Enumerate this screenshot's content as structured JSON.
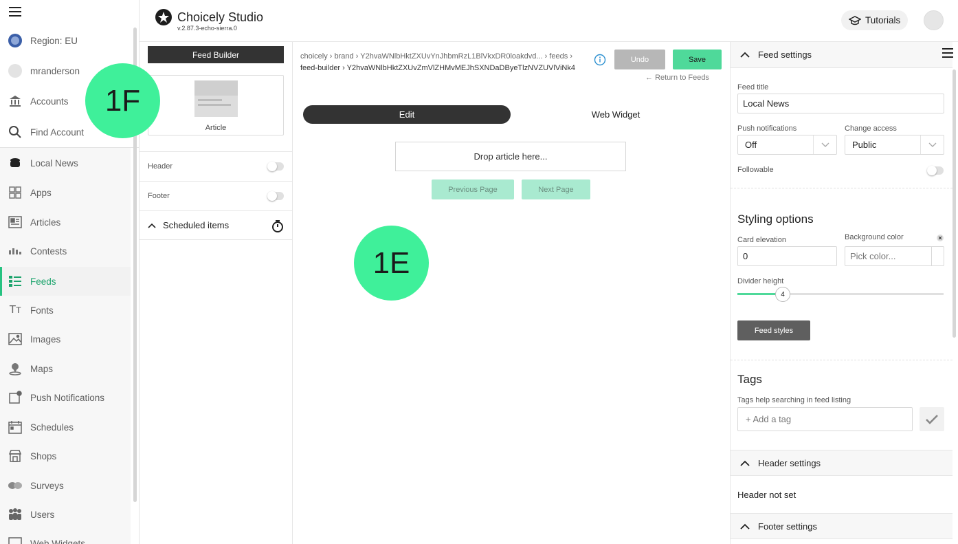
{
  "app": {
    "title": "Choicely Studio",
    "version": "v.2.87.3-echo-sierra.0",
    "tutorials_label": "Tutorials"
  },
  "nav": {
    "region": "Region: EU",
    "user": "mranderson",
    "accounts": "Accounts",
    "find_account": "Find Account",
    "items": [
      {
        "label": "Local News",
        "icon": "stack-icon"
      },
      {
        "label": "Apps",
        "icon": "grid-icon"
      },
      {
        "label": "Articles",
        "icon": "article-icon"
      },
      {
        "label": "Contests",
        "icon": "contest-icon"
      },
      {
        "label": "Feeds",
        "icon": "feeds-icon",
        "active": true
      },
      {
        "label": "Fonts",
        "icon": "fonts-icon"
      },
      {
        "label": "Images",
        "icon": "images-icon"
      },
      {
        "label": "Maps",
        "icon": "map-pin-icon"
      },
      {
        "label": "Push Notifications",
        "icon": "push-icon"
      },
      {
        "label": "Schedules",
        "icon": "calendar-icon"
      },
      {
        "label": "Shops",
        "icon": "shop-icon"
      },
      {
        "label": "Surveys",
        "icon": "survey-icon"
      },
      {
        "label": "Users",
        "icon": "users-icon"
      },
      {
        "label": "Web Widgets",
        "icon": "widget-icon"
      }
    ],
    "active_color": "#26c281"
  },
  "feed_builder": {
    "title": "Feed Builder",
    "article_label": "Article",
    "header_label": "Header",
    "footer_label": "Footer",
    "scheduled_label": "Scheduled items"
  },
  "breadcrumb": {
    "line1": [
      "choicely",
      "brand",
      "Y2hvaWNlbHktZXUvYnJhbmRzL1BlVkxDR0loakdvd...",
      "feeds"
    ],
    "line2": [
      "feed-builder",
      "Y2hvaWNlbHktZXUvZmVlZHMvMEJhSXNDaDByeTlzNVZUVlViNk4"
    ]
  },
  "actions": {
    "undo": "Undo",
    "save": "Save",
    "return": "Return to Feeds"
  },
  "tabs": {
    "edit": "Edit",
    "web_widget": "Web Widget"
  },
  "canvas": {
    "drop_text": "Drop article here...",
    "previous_page": "Previous Page",
    "next_page": "Next Page"
  },
  "callouts": {
    "a": "1F",
    "b": "1E"
  },
  "settings": {
    "feed_settings": "Feed settings",
    "feed_title_label": "Feed title",
    "feed_title_value": "Local News",
    "push_label": "Push notifications",
    "push_value": "Off",
    "access_label": "Change access",
    "access_value": "Public",
    "followable_label": "Followable",
    "styling_title": "Styling options",
    "card_elevation_label": "Card elevation",
    "card_elevation_value": "0",
    "bg_color_label": "Background color",
    "bg_color_placeholder": "Pick color...",
    "divider_label": "Divider height",
    "divider_value": "4",
    "divider_fraction": 0.22,
    "feed_styles": "Feed styles",
    "tags_title": "Tags",
    "tags_help": "Tags help searching in feed listing",
    "tag_placeholder": "+ Add a tag",
    "header_settings": "Header settings",
    "header_not_set": "Header not set",
    "footer_settings": "Footer settings"
  }
}
